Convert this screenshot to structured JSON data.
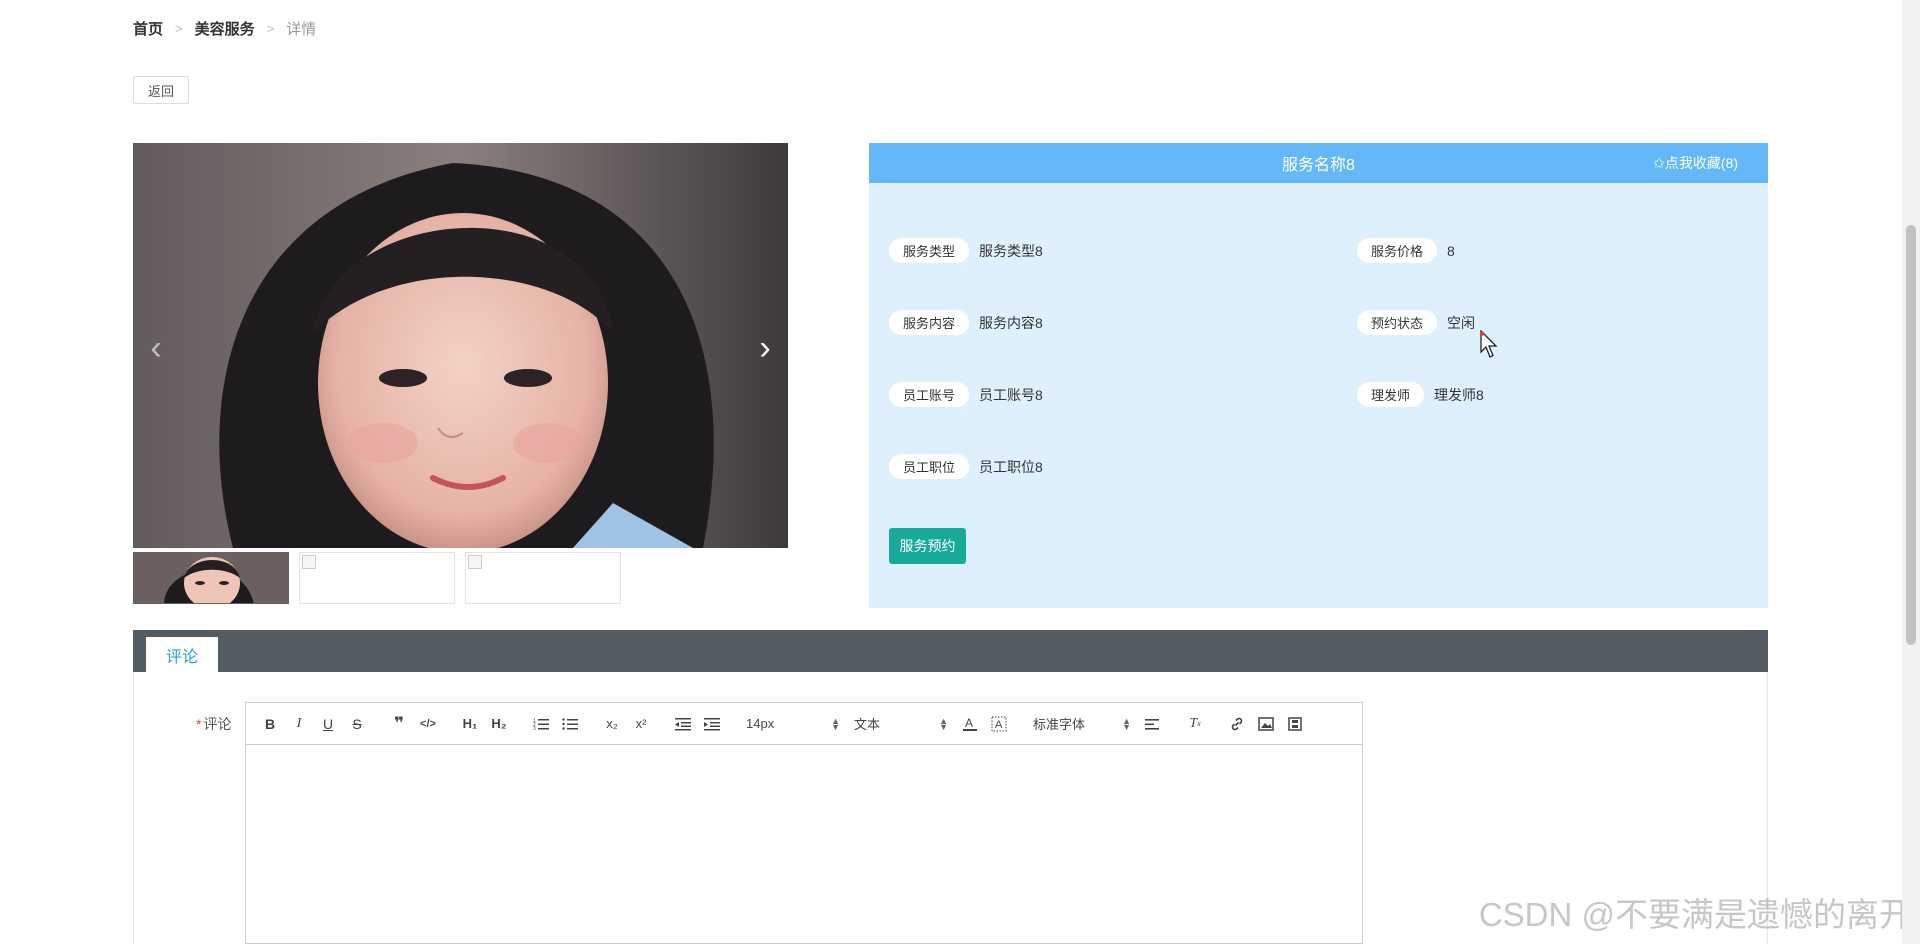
{
  "breadcrumb": {
    "home": "首页",
    "section": "美容服务",
    "current": "详情",
    "sep1": ">",
    "sep2": ">"
  },
  "back_button": "返回",
  "carousel": {
    "prev": "‹",
    "next": "›"
  },
  "service": {
    "title": "服务名称8",
    "favorite": "✩点我收藏(8)",
    "fields": [
      {
        "label": "服务类型",
        "value": "服务类型8"
      },
      {
        "label": "服务价格",
        "value": "8"
      },
      {
        "label": "服务内容",
        "value": "服务内容8"
      },
      {
        "label": "预约状态",
        "value": "空闲"
      },
      {
        "label": "员工账号",
        "value": "员工账号8"
      },
      {
        "label": "理发师",
        "value": "理发师8"
      },
      {
        "label": "员工职位",
        "value": "员工职位8"
      }
    ],
    "book_button": "服务预约"
  },
  "comments": {
    "tab": "评论",
    "field_label": "评论",
    "required_mark": "*",
    "toolbar": {
      "size": "14px",
      "block": "文本",
      "font": "标准字体"
    }
  },
  "watermark": "CSDN @不要满是遗憾的离开",
  "colors": {
    "header_blue": "#64b8f7",
    "panel_bg": "#dff0fd",
    "book_btn": "#17aa9a",
    "comment_bar": "#535b63",
    "tab_text": "#1ea0d8"
  }
}
